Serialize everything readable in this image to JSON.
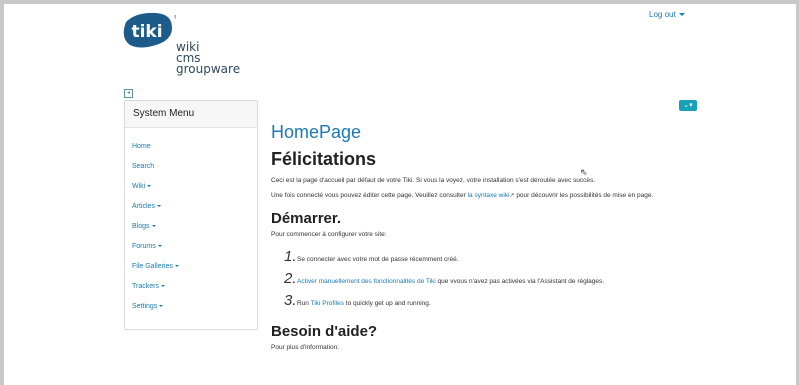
{
  "header": {
    "logo": {
      "brand": "tiki",
      "lines": [
        "wiki",
        "cms",
        "groupware"
      ]
    },
    "logout_label": "Log out"
  },
  "sidebar": {
    "title": "System Menu",
    "items": [
      {
        "label": "Home",
        "dropdown": false
      },
      {
        "label": "Search",
        "dropdown": false
      },
      {
        "label": "Wiki",
        "dropdown": true
      },
      {
        "label": "Articles",
        "dropdown": true
      },
      {
        "label": "Blogs",
        "dropdown": true
      },
      {
        "label": "Forums",
        "dropdown": true
      },
      {
        "label": "File Galleries",
        "dropdown": true
      },
      {
        "label": "Trackers",
        "dropdown": true
      },
      {
        "label": "Settings",
        "dropdown": true
      }
    ]
  },
  "main": {
    "page_title": "HomePage",
    "heading": "Félicitations",
    "intro": "Ceci est la page d'accueil par défaut de votre Tiki. Si vous la voyez, votre installation s'est déroulée avec succès.",
    "edit_before": "Une fois connecté vous pouvez éditer cette page. Veuillez consulter ",
    "edit_link": "la syntaxe wiki",
    "edit_after": " pour découvrir les possibilités de mise en page.",
    "start_heading": "Démarrer.",
    "start_intro": "Pour commencer à configurer votre site:",
    "steps": [
      {
        "num": "1.",
        "text": "Se connecter avec votre mot de passe récemment créé."
      },
      {
        "num": "2.",
        "link": "Activer manuellement des fonctionnalités de Tiki",
        "text_after": " que vvous n'avez pas activées via l'Assistant de réglages."
      },
      {
        "num": "3.",
        "text_before": "Run ",
        "link": "Tiki Profiles",
        "text_after": " to quickly get up and running."
      }
    ],
    "help_heading": "Besoin d'aide?",
    "help_intro": "Pour plus d'information:"
  },
  "colors": {
    "link": "#1a7ab5",
    "accent": "#17a2b8",
    "logo_blue": "#1d5c8a"
  }
}
